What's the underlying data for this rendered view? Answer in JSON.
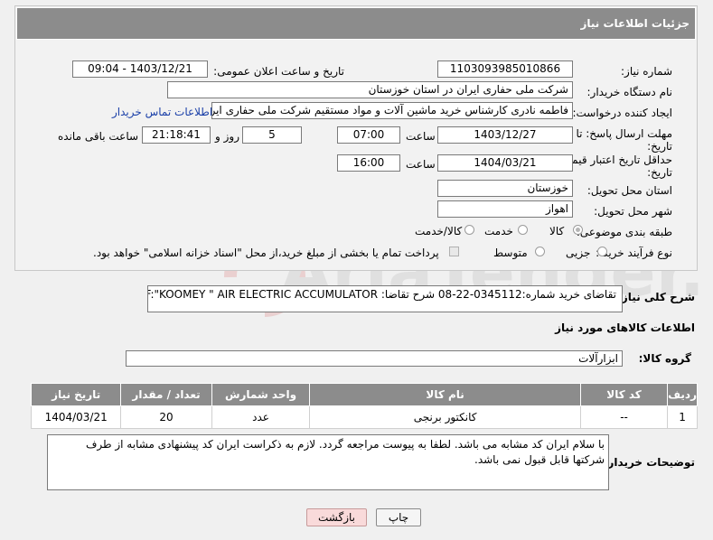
{
  "header": {
    "title": "جزئیات اطلاعات نیاز"
  },
  "fields": {
    "need_number": {
      "label": "شماره نیاز:",
      "value": "1103093985010866"
    },
    "announce_datetime": {
      "label": "تاریخ و ساعت اعلان عمومی:",
      "value": "1403/12/21 - 09:04"
    },
    "buyer_org": {
      "label": "نام دستگاه خریدار:",
      "value": "شرکت ملی حفاری ایران در استان خوزستان"
    },
    "requester": {
      "label": "ایجاد کننده درخواست:",
      "value": "فاطمه نادری کارشناس خرید ماشین آلات و مواد مستقیم شرکت ملی حفاری ایر",
      "contact_link": "اطلاعات تماس خریدار"
    },
    "reply_deadline": {
      "label_line1": "مهلت ارسال پاسخ: تا",
      "label_line2": "تاریخ:",
      "date": "1403/12/27",
      "time_label": "ساعت",
      "time": "07:00",
      "days": "5",
      "days_label": "روز و",
      "remaining": "21:18:41",
      "remaining_label": "ساعت باقی مانده"
    },
    "price_validity": {
      "label_line1": "حداقل تاریخ اعتبار قیمت: تا",
      "label_line2": "تاریخ:",
      "date": "1404/03/21",
      "time_label": "ساعت",
      "time": "16:00"
    },
    "delivery_province": {
      "label": "استان محل تحویل:",
      "value": "خوزستان"
    },
    "delivery_city": {
      "label": "شهر محل تحویل:",
      "value": "اهواز"
    },
    "category": {
      "label": "طبقه بندی موضوعی:",
      "options": [
        "کالا",
        "خدمت",
        "کالا/خدمت"
      ],
      "selected": "کالا"
    },
    "process_type": {
      "label": "نوع فرآیند خرید :",
      "options": [
        "جزیی",
        "متوسط"
      ],
      "payment_note": "پرداخت تمام یا بخشی از مبلغ خرید،از محل \"اسناد خزانه اسلامی\" خواهد بود."
    }
  },
  "description": {
    "label": "شرح کلی نیاز:",
    "value": "تقاضای خرید شماره:0345112-22-08 شرح تقاضا: P/F:\"KOOMEY \" AIR ELECTRIC ACCUMULATOR"
  },
  "goods_section": {
    "title": "اطلاعات کالاهای مورد نیاز",
    "group_label": "گروه کالا:",
    "group_value": "ابزارآلات"
  },
  "table": {
    "headers": [
      "ردیف",
      "کد کالا",
      "نام کالا",
      "واحد شمارش",
      "تعداد / مقدار",
      "تاریخ نیاز"
    ],
    "rows": [
      [
        "1",
        "--",
        "کانکتور برنجی",
        "عدد",
        "20",
        "1404/03/21"
      ]
    ]
  },
  "buyer_notes": {
    "label": "توضیحات خریدار:",
    "value": "با سلام ایران کد مشابه می باشد. لطفا به پیوست مراجعه گردد. لازم به ذکراست ایران کد پیشنهادی مشابه از طرف شرکتها قابل قبول نمی باشد."
  },
  "buttons": {
    "print": "چاپ",
    "back": "بازگشت"
  },
  "watermark": {
    "text": "AriaTender.neT"
  }
}
